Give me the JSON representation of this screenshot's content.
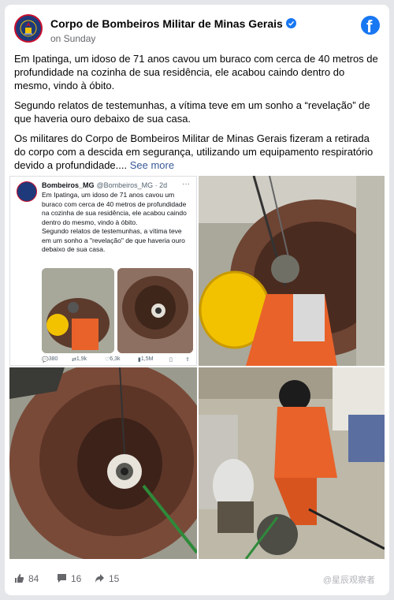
{
  "header": {
    "page_name": "Corpo de Bombeiros Militar de Minas Gerais",
    "post_time": "on Sunday"
  },
  "post": {
    "paragraph_1": "Em Ipatinga, um idoso de 71 anos cavou um buraco com cerca de 40 metros de profundidade na cozinha de sua residência, ele acabou caindo dentro do mesmo, vindo à óbito.",
    "paragraph_2": "Segundo relatos de testemunhas, a vítima teve em um sonho a “revelação” de que haveria ouro debaixo de sua casa.",
    "paragraph_3": "Os militares do Corpo de Bombeiros Militar de Minas Gerais fizeram a retirada do corpo com a descida em segurança, utilizando um equipamento respiratório devido a profundidade....",
    "see_more": "See more"
  },
  "tweet": {
    "name": "Bombeiros_MG",
    "handle": "@Bombeiros_MG · 2d",
    "text_1": "Em Ipatinga, um idoso de 71 anos cavou um buraco com cerca de 40 metros de profundidade na cozinha de sua residência, ele acabou caindo dentro do mesmo, vindo à óbito.",
    "text_2": "Segundo relatos de testemunhas, a vítima teve em um sonho a \"revelação\" de que haveria ouro debaixo de sua casa.",
    "replies": "380",
    "retweets": "1,9k",
    "likes": "6,3k",
    "views": "1,5M"
  },
  "reactions": {
    "likes": "84",
    "comments": "16",
    "shares": "15"
  },
  "watermark": "@星辰观察者",
  "colors": {
    "facebook_blue": "#1877f2",
    "link": "#385898",
    "secondary_text": "#65676b",
    "helmet_yellow": "#f2c200",
    "uniform_orange": "#e8622a"
  }
}
